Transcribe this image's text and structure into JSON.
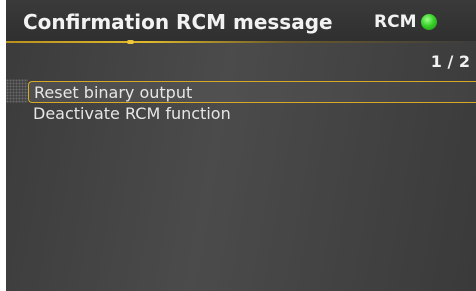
{
  "header": {
    "title": "Confirmation RCM message",
    "status_label": "RCM",
    "status_led_color": "#39d22a"
  },
  "page": {
    "indicator": "1 / 2"
  },
  "menu": {
    "items": [
      {
        "label": "Reset binary output",
        "selected": true
      },
      {
        "label": "Deactivate RCM function",
        "selected": false
      }
    ]
  },
  "colors": {
    "accent": "#e0b92c",
    "background": "#444444",
    "text": "#e6e6e6"
  }
}
